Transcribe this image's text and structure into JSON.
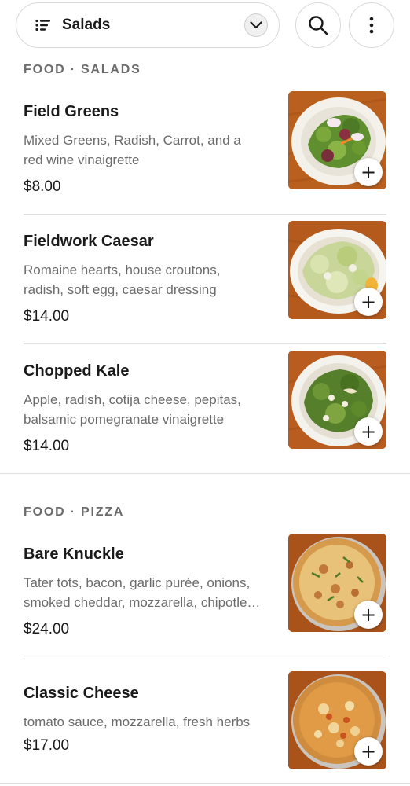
{
  "header": {
    "category_label": "Salads",
    "icons": {
      "list": "list-icon",
      "chevron": "chevron-down-icon",
      "search": "search-icon",
      "more": "more-vertical-icon"
    }
  },
  "sections": [
    {
      "title": "FOOD · SALADS",
      "items": [
        {
          "name": "Field Greens",
          "description": "Mixed Greens, Radish, Carrot, and a red wine vinaigrette",
          "price": "$8.00",
          "add_label": "+"
        },
        {
          "name": "Fieldwork Caesar",
          "description": "Romaine hearts, house croutons, radish, soft egg, caesar dressing",
          "price": "$14.00",
          "add_label": "+"
        },
        {
          "name": "Chopped Kale",
          "description": "Apple, radish, cotija cheese, pepitas, balsamic pomegranate vinaigrette",
          "price": "$14.00",
          "add_label": "+"
        }
      ]
    },
    {
      "title": "FOOD · PIZZA",
      "items": [
        {
          "name": "Bare Knuckle",
          "description": "Tater tots, bacon, garlic purée, onions, smoked cheddar, mozzarella, chipotle…",
          "price": "$24.00",
          "add_label": "+"
        },
        {
          "name": "Classic Cheese",
          "description": "tomato sauce, mozzarella, fresh herbs",
          "price": "$17.00",
          "add_label": "+"
        }
      ]
    }
  ],
  "colors": {
    "text": "#1a1a1a",
    "muted": "#6b6b6b",
    "border": "#d9d9d9",
    "wood": "#b5581f"
  }
}
